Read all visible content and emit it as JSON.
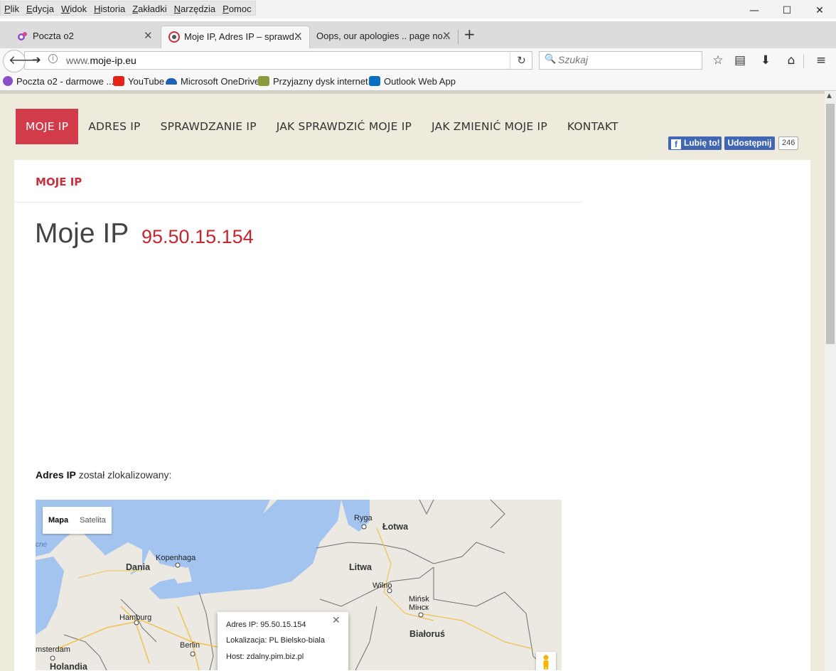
{
  "browser": {
    "menu": [
      "Plik",
      "Edycja",
      "Widok",
      "Historia",
      "Zakładki",
      "Narzędzia",
      "Pomoc"
    ],
    "window_controls": {
      "minimize": "—",
      "maximize": "☐",
      "close": "✕"
    },
    "tabs": [
      {
        "title": "Poczta o2",
        "active": false
      },
      {
        "title": "Moje IP, Adres IP – sprawd...",
        "active": true
      },
      {
        "title": "Oops, our apologies .. page no...",
        "active": false
      }
    ],
    "new_tab": "+",
    "url_host_prefix": "www.",
    "url_host": "moje-ip.eu",
    "search_placeholder": "Szukaj",
    "bookmarks": [
      {
        "label": "Poczta o2 - darmowe ...",
        "icon": "o2-icon",
        "color": "#8a4fc8"
      },
      {
        "label": "YouTube",
        "icon": "youtube-icon",
        "color": "#e62117"
      },
      {
        "label": "Microsoft OneDrive",
        "icon": "onedrive-icon",
        "color": "#1f5fb4"
      },
      {
        "label": "Przyjazny dysk internet...",
        "icon": "przyjazny-dysk-icon",
        "color": "#8a9a3a"
      },
      {
        "label": "Outlook Web App",
        "icon": "outlook-icon",
        "color": "#0a6fc2"
      }
    ]
  },
  "site": {
    "nav": [
      "MOJE IP",
      "ADRES IP",
      "SPRAWDZANIE IP",
      "JAK SPRAWDZIĆ MOJE IP",
      "JAK ZMIENIĆ MOJE IP",
      "KONTAKT"
    ],
    "fb": {
      "like": "Lubię to!",
      "share": "Udostępnij",
      "count": "246"
    },
    "breadcrumb": "MOJE IP",
    "heading": "Moje IP",
    "ip": "95.50.15.154",
    "located_bold": "Adres IP",
    "located_rest": " został zlokalizowany:"
  },
  "map": {
    "toggle": [
      "Mapa",
      "Satelita"
    ],
    "info": {
      "ip": "Adres IP: 95.50.15.154",
      "location": "Lokalizacja: PL Bielsko-biala",
      "host": "Host: zdalny.pim.biz.pl"
    },
    "labels": {
      "ryga": "Ryga",
      "lotwa": "Łotwa",
      "kopenhaga": "Kopenhaga",
      "dania": "Dania",
      "litwa": "Litwa",
      "wilno": "Wilno",
      "minsk": "Mińsk",
      "minsk_cyr": "Мінск",
      "bialorus": "Białoruś",
      "hamburg": "Hamburg",
      "berlin": "Berlin",
      "amsterdam": "msterdam",
      "holandia": "Holandia",
      "edge": "cne"
    },
    "colors": {
      "water": "#a4c4f0",
      "land": "#ebe9e1",
      "border": "#6f6f6f",
      "road": "#f2c14f"
    }
  },
  "colors": {
    "accent": "#d23c4a",
    "ip": "#c8242f",
    "page_bg": "#eeeadc",
    "fb": "#4267b2"
  }
}
